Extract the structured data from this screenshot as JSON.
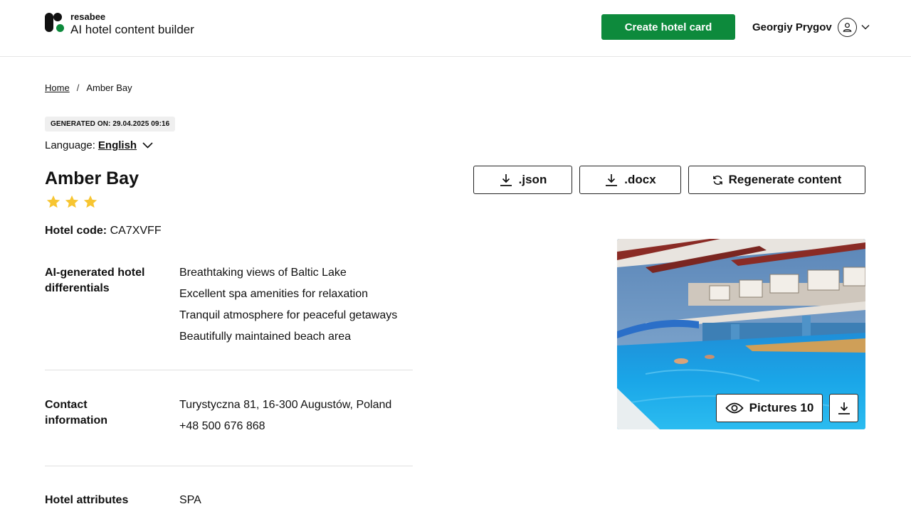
{
  "header": {
    "brand": "resabee",
    "tagline": "AI hotel content builder",
    "create_button": "Create hotel card",
    "user_name": "Georgiy Prygov"
  },
  "breadcrumb": {
    "home": "Home",
    "separator": "/",
    "current": "Amber Bay"
  },
  "generated_badge": "GENERATED ON: 29.04.2025 09:16",
  "language": {
    "label": "Language:",
    "value": "English"
  },
  "hotel": {
    "name": "Amber Bay",
    "stars": 3,
    "code_label": "Hotel code:",
    "code_value": "CA7XVFF"
  },
  "actions": {
    "json": ".json",
    "docx": ".docx",
    "regenerate": "Regenerate content"
  },
  "sections": {
    "differentials": {
      "label": "AI-generated hotel differentials",
      "items": [
        "Breathtaking views of Baltic Lake",
        "Excellent spa amenities for relaxation",
        "Tranquil atmosphere for peaceful getaways",
        "Beautifully maintained beach area"
      ]
    },
    "contact": {
      "label": "Contact information",
      "address": "Turystyczna 81, 16-300 Augustów, Poland",
      "phone": "+48 500 676 868"
    },
    "attributes": {
      "label": "Hotel attributes",
      "items": [
        "SPA"
      ]
    }
  },
  "photo": {
    "pictures_label": "Pictures 10"
  },
  "colors": {
    "primary": "#0d8a3c",
    "star": "#f7c531",
    "badge_bg": "#efefef"
  },
  "icons": {
    "logo": "resabee-logo-icon",
    "user": "user-avatar-icon",
    "chevron": "chevron-down-icon",
    "download": "download-icon",
    "refresh": "refresh-icon",
    "eye": "eye-icon",
    "star": "star-icon"
  }
}
